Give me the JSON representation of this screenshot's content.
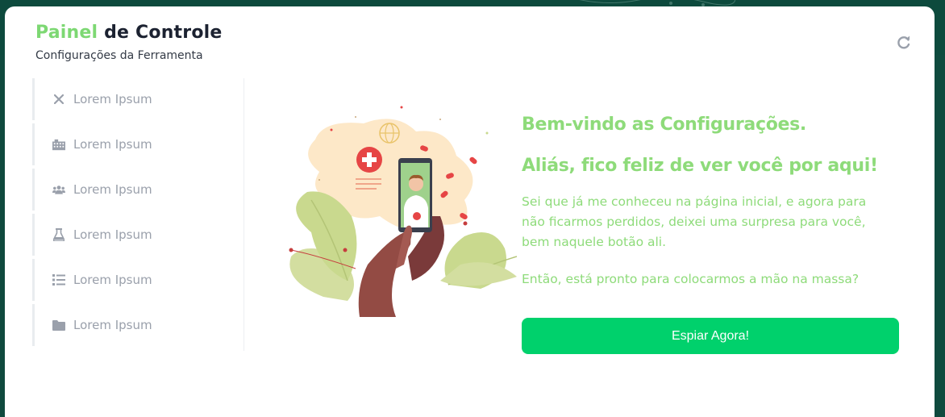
{
  "header": {
    "title_accent": "Painel",
    "title_rest": " de Controle",
    "subtitle": "Configurações da Ferramenta"
  },
  "sidebar": {
    "items": [
      {
        "label": "Lorem Ipsum",
        "icon": "close-icon"
      },
      {
        "label": "Lorem Ipsum",
        "icon": "building-icon"
      },
      {
        "label": "Lorem Ipsum",
        "icon": "users-icon"
      },
      {
        "label": "Lorem Ipsum",
        "icon": "flask-icon"
      },
      {
        "label": "Lorem Ipsum",
        "icon": "list-icon"
      },
      {
        "label": "Lorem Ipsum",
        "icon": "folder-icon"
      }
    ]
  },
  "welcome": {
    "heading1": "Bem-vindo as Configurações.",
    "heading2": "Aliás, fico feliz de ver você por aqui!",
    "paragraph1": "Sei que já me conheceu na página inicial, e agora para não ficarmos perdidos, deixei uma surpresa para você, bem naquele botão ali.",
    "paragraph2": "Então, está pronto para colocarmos a mão na massa?",
    "button": "Espiar Agora!"
  },
  "colors": {
    "accent_green": "#7dd873",
    "button_green": "#00d16c",
    "top_band": "#0d4a3d"
  }
}
